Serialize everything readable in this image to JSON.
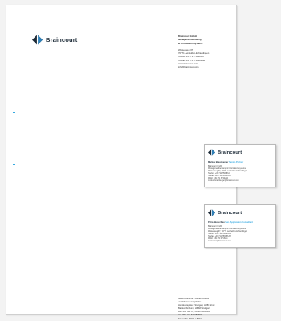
{
  "brand": {
    "name": "Braincourt",
    "colors": {
      "navy": "#1d2b38",
      "blue": "#36a9e1",
      "darkblue": "#0a5e8f"
    },
    "logo_icon": "diamond-logo-icon"
  },
  "letterhead": {
    "sender": {
      "company": "Braincourt GmbH",
      "line2": "Managementberatung",
      "line3": "& Informationssysteme",
      "street": "Wüstenweg 37",
      "city": "70771 Leinfelden-Echterdingen",
      "phone": "Telefon +49 711 758486-0",
      "fax": "Telefax +49 711 758486-88",
      "web": "www.braincourt.com",
      "email": "info@braincourt.com"
    },
    "footer": [
      "Geschäftsführer: Günter Krauss",
      "und Thomas Gutjahr/ler",
      "Handelsregister: Stuttgart, HRB 12xxx",
      "Bankverbindung: LBBW Stuttgart",
      "BLZ 600 501 01, Konto 2060594",
      "Ust-IdNr. DE 813480650",
      "Steuer-Nr. 99021 / 5304"
    ]
  },
  "cards": [
    {
      "name": "Markus Braunberger",
      "role": "Senior-Partner",
      "lines": [
        "Braincourt GmbH",
        "Managementberatung & Informationssysteme",
        "Wüstenweg 37, 70771 Leinfelden-Echterdingen",
        "Telefon: +49 711 758486-0",
        "Telefax: +49 711 758486-88",
        "Mobil:   +49 171 6744x44",
        "markus.braunberger@braincourt.com"
      ]
    },
    {
      "name": "Petra Musterfrau",
      "role": "Sen. Application Consultant",
      "lines": [
        "Braincourt GmbH",
        "Managementberatung & Informationssysteme",
        "Wüstenweg 37, 70771 Leinfelden-Echterdingen",
        "Telefon: +49 711 758486-14",
        "Telefax: +49 711 758486-88",
        "Mobil:   +49 173 47x5xxx",
        "musterfrau@braincourt.com"
      ]
    }
  ]
}
